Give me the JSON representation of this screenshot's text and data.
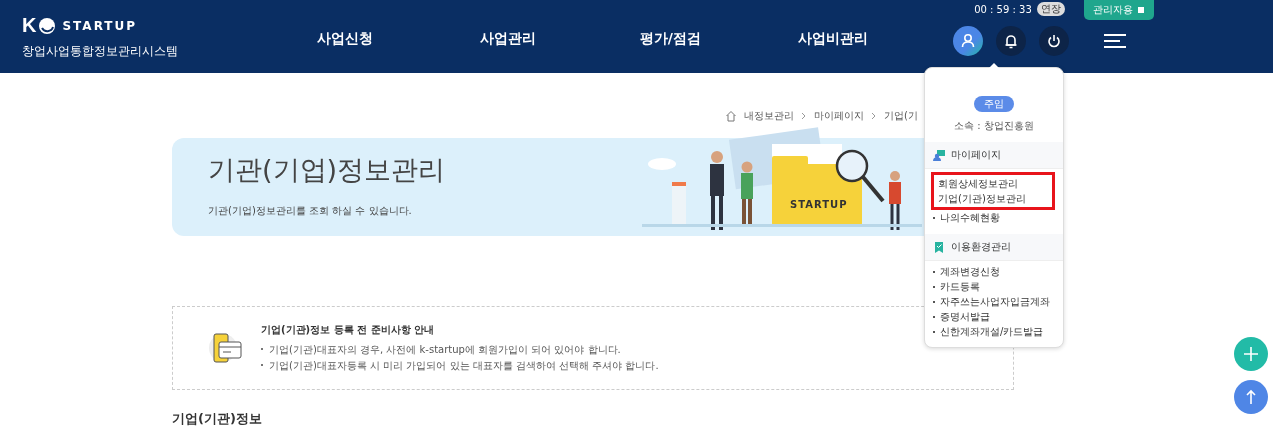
{
  "header": {
    "logo_letter": "K",
    "logo_text": "STARTUP",
    "system_name": "창업사업통합정보관리시스템",
    "nav": [
      {
        "label": "사업신청",
        "selected": false
      },
      {
        "label": "사업관리",
        "selected": false
      },
      {
        "label": "평가/점검",
        "selected": false
      },
      {
        "label": "사업비관리",
        "selected": false
      }
    ],
    "timer": "00 : 59 : 33",
    "extend_button": "연장",
    "admin_button": "관리자용",
    "icons": [
      {
        "kind": "user",
        "selected": true
      },
      {
        "kind": "bell",
        "selected": false
      },
      {
        "kind": "power",
        "selected": false
      },
      {
        "kind": "menu"
      }
    ]
  },
  "breadcrumb": [
    "내정보관리",
    "마이페이지",
    "기업(기"
  ],
  "banner": {
    "title": "기관(기업)정보관리",
    "subtitle": "기관(기업)정보관리를 조회 하실 수 있습니다.",
    "folder_logo": "STARTUP"
  },
  "notice": {
    "title": "기업(기관)정보 등록 전 준비사항 안내",
    "items": [
      "기업(기관)대표자의 경우, 사전에 k-startup에 회원가입이 되어 있어야 합니다.",
      "기업(기관)대표자등록 시 미리 가입되어 있는 대표자를 검색하여 선택해 주셔야 합니다."
    ]
  },
  "section_heading": "기업(기관)정보",
  "user_menu": {
    "rank": "주임",
    "affiliation": "소속 : 창업진흥원",
    "sections": [
      {
        "kind": "mypage",
        "title": "마이페이지",
        "items": [
          {
            "label": "회원상세정보관리",
            "highlighted": true
          },
          {
            "label": "기업(기관)정보관리",
            "highlighted": true
          },
          {
            "label": "나의수혜현황",
            "highlighted": false
          }
        ]
      },
      {
        "kind": "settings",
        "title": "이용환경관리",
        "items": [
          {
            "label": "계좌변경신청",
            "highlighted": false
          },
          {
            "label": "카드등록",
            "highlighted": false
          },
          {
            "label": "자주쓰는사업자입금계좌",
            "highlighted": false
          },
          {
            "label": "증명서발급",
            "highlighted": false
          },
          {
            "label": "신한계좌개설/카드발급",
            "highlighted": false
          }
        ]
      }
    ]
  },
  "fabs": [
    {
      "kind": "plus"
    },
    {
      "kind": "top"
    }
  ]
}
